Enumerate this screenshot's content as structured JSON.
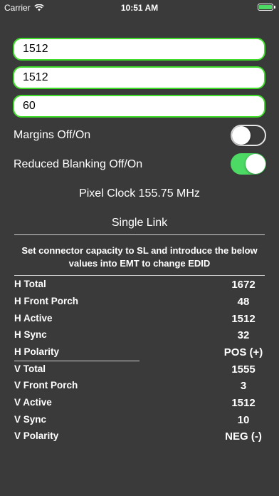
{
  "status": {
    "carrier": "Carrier",
    "time": "10:51 AM"
  },
  "inputs": [
    "1512",
    "1512",
    "60"
  ],
  "toggles": [
    {
      "label": "Margins Off/On",
      "state": "off"
    },
    {
      "label": "Reduced Blanking Off/On",
      "state": "on"
    }
  ],
  "pixel_clock": "Pixel Clock 155.75 MHz",
  "link_type": "Single Link",
  "instruction": "Set connector capacity to SL and introduce the below values into EMT to change EDID",
  "timings": [
    {
      "label": "H Total",
      "value": "1672"
    },
    {
      "label": "H Front Porch",
      "value": "48"
    },
    {
      "label": "H Active",
      "value": "1512"
    },
    {
      "label": "H Sync",
      "value": "32"
    },
    {
      "label": "H Polarity",
      "value": "POS (+)"
    },
    {
      "label": "V Total",
      "value": "1555"
    },
    {
      "label": "V Front Porch",
      "value": "3"
    },
    {
      "label": "V Active",
      "value": "1512"
    },
    {
      "label": "V Sync",
      "value": "10"
    },
    {
      "label": "V Polarity",
      "value": "NEG (-)"
    }
  ]
}
